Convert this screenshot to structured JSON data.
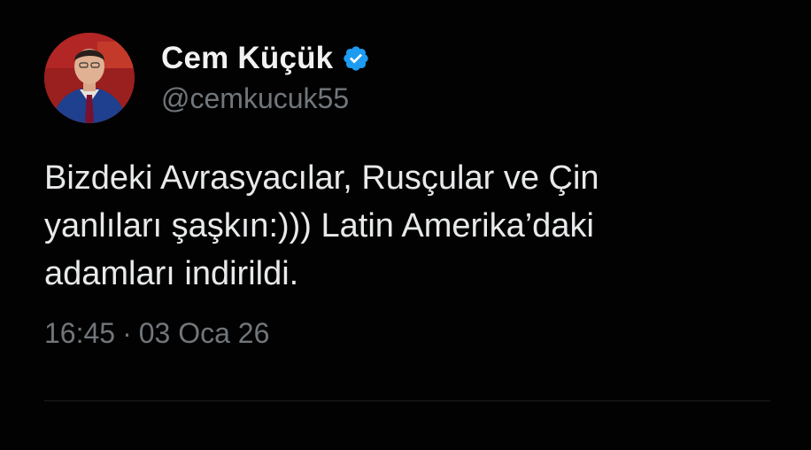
{
  "author": {
    "display_name": "Cem Küçük",
    "handle": "@cemkucuk55",
    "verified": true,
    "verified_icon": "verified-badge-icon",
    "verified_color": "#1d9bf0"
  },
  "post": {
    "text": "Bizdeki Avrasyacılar, Rusçular ve Çin\nyanlıları şaşkın:))) Latin Amerika’daki\nadamları indirildi.",
    "time": "16:45",
    "separator": "·",
    "date": "03 Oca 26"
  },
  "colors": {
    "background": "#000000",
    "text": "#e7e9ea",
    "secondary_text": "#71767b"
  }
}
